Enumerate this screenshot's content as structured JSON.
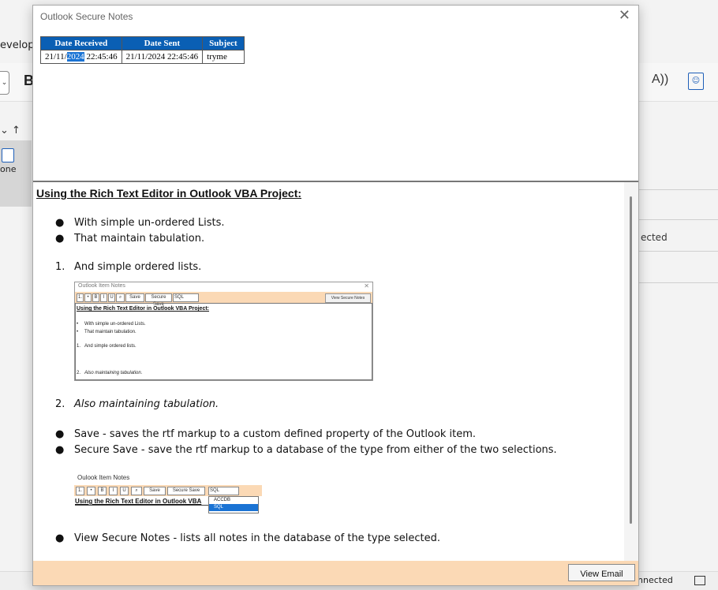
{
  "background": {
    "ribbon_tab_fragment": "evelope",
    "bold_button": "B",
    "read_aloud_icon": "A))",
    "accessibility_icon": "accessibility-icon",
    "sort_arrows": "⌄  ↑",
    "pane_label": "one",
    "status_text": "nnected"
  },
  "dialog": {
    "title": "Outlook Secure Notes",
    "close_glyph": "✕",
    "notes_table": {
      "headers": [
        "Date Received",
        "Date Sent",
        "Subject"
      ],
      "rows": [
        {
          "date_received_prefix": "21/11/",
          "date_received_selected": "2024",
          "date_received_suffix": " 22:45:46",
          "date_sent": "21/11/2024 22:45:46",
          "subject": "tryme"
        }
      ]
    },
    "editor": {
      "heading": "Using the Rich Text Editor in Outlook VBA Project:",
      "bullets1": [
        "With simple un-ordered Lists.",
        "That maintain tabulation."
      ],
      "ordered1": {
        "marker": "1.",
        "text": "And simple ordered lists."
      },
      "ordered2": {
        "marker": "2.",
        "text": "Also maintaining tabulation."
      },
      "bullets2": [
        "Save - saves the rtf markup to a custom defined property of the Outlook item.",
        "Secure Save - save the rtf markup to a database of the type from either of the two selections."
      ],
      "bullets3": [
        "View Secure Notes - lists all notes in the database of the type selected."
      ],
      "screenshot1": {
        "title": "Outlook Item Notes",
        "toolbar_buttons": [
          "1.",
          "•",
          "B",
          "I",
          "U",
          "⌕",
          "Save",
          "Secure Save",
          "SQL"
        ],
        "view_button": "View Secure Notes",
        "heading": "Using the Rich Text Editor in Outlook VBA Project:",
        "lines": [
          "With simple un-ordered Lists.",
          "That maintain tabulation.",
          "And simple ordered lists.",
          "Also maintaining tabulation."
        ],
        "markers": [
          "•",
          "•",
          "1.",
          "2."
        ]
      },
      "screenshot2": {
        "title": "Oulook Item Notes",
        "toolbar_buttons": [
          "1.",
          "•",
          "B",
          "I",
          "U",
          "⌕",
          "Save",
          "Secure Save",
          "SQL"
        ],
        "heading": "Using the Rich Text Editor in Outlook VBA",
        "dropdown_options": [
          "ACCDB",
          "SQL"
        ],
        "selected_option": "SQL"
      }
    },
    "footer": {
      "view_email_label": "View Email"
    }
  },
  "colors": {
    "header_blue": "#0a5fb4",
    "selection_blue": "#1a73d4",
    "toolbar_peach": "#fbd9b5"
  }
}
